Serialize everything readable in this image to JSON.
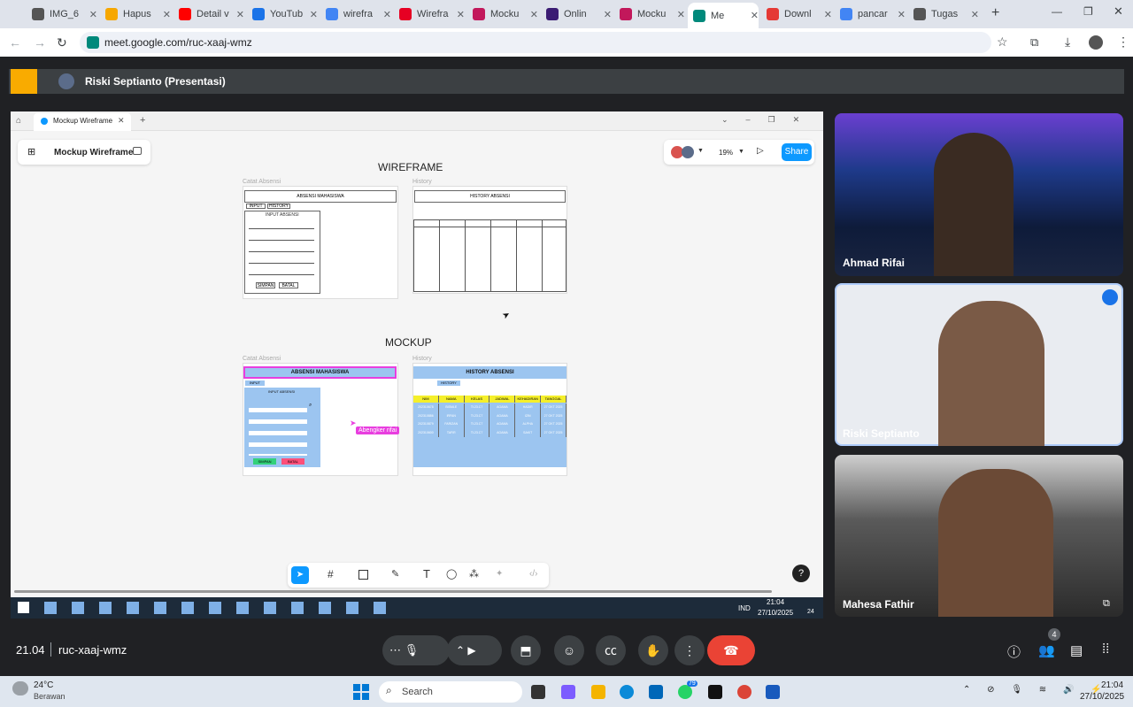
{
  "browser": {
    "tabs": [
      {
        "label": "IMG_6",
        "color": "#555"
      },
      {
        "label": "Hapus",
        "color": "#f6a700"
      },
      {
        "label": "Detail v",
        "color": "#ff0000"
      },
      {
        "label": "YouTub",
        "color": "#1a73e8"
      },
      {
        "label": "wirefra",
        "color": "#4285f4"
      },
      {
        "label": "Wirefra",
        "color": "#e60023"
      },
      {
        "label": "Mocku",
        "color": "#c2185b"
      },
      {
        "label": "Onlin",
        "color": "#3b1c73"
      },
      {
        "label": "Mocku",
        "color": "#c2185b"
      },
      {
        "label": "Me",
        "color": "#00897b"
      },
      {
        "label": "Downl",
        "color": "#e53935"
      },
      {
        "label": "pancar",
        "color": "#4285f4"
      },
      {
        "label": "Tugas",
        "color": "#555"
      }
    ],
    "url": "meet.google.com/ruc-xaaj-wmz"
  },
  "meet": {
    "presenter": "Riski Septianto (Presentasi)",
    "time": "21.04",
    "meeting_code": "ruc-xaaj-wmz",
    "participants_count": "4",
    "participants": [
      {
        "name": "Ahmad Rifai"
      },
      {
        "name": "Riski Septianto"
      },
      {
        "name": "Mahesa Fathir"
      }
    ]
  },
  "figma": {
    "window_title": "Mockup Wireframe",
    "file_name": "Mockup Wireframe",
    "zoom": "19%",
    "share_label": "Share",
    "sections": {
      "wireframe_title": "WIREFRAME",
      "mockup_title": "MOCKUP"
    },
    "frames": {
      "catat_absensi": "Catat Absensi",
      "history": "History",
      "absensi_mahasiswa": "ABSENSI MAHASISWA",
      "history_absensi": "HISTORY ABSENSI",
      "input_absensi": "INPUT ABSENSI",
      "tab_input": "INPUT",
      "tab_history": "HISTORY",
      "simpan": "SIMPAN",
      "batal": "BATAL",
      "table_headers": [
        "NIM",
        "NAMA",
        "KELAS",
        "JADWAL",
        "KEHADIRAN",
        "TANGGAL"
      ],
      "table_rows": [
        [
          "202310678",
          "BISMLE",
          "TI.23.C7",
          "AGAMA",
          "HADIR",
          "27 OKT 2025"
        ],
        [
          "202310886",
          "IRFAN",
          "TI.23.C7",
          "AGAMA",
          "IZIN",
          "27 OKT 2025"
        ],
        [
          "202310879",
          "FARIZAN",
          "TI.23.C7",
          "AGAMA",
          "ALPHA",
          "27 OKT 2025"
        ],
        [
          "202310600",
          "TAFIR",
          "TI.23.C7",
          "AGAMA",
          "SAKIT",
          "27 OKT 2025"
        ]
      ],
      "collaborator_cursor": "Abengker rifai"
    }
  },
  "inner_taskbar": {
    "language": "IND",
    "time": "21:04",
    "date": "27/10/2025",
    "notif": "24"
  },
  "taskbar": {
    "weather_temp": "24°C",
    "weather_desc": "Berawan",
    "search_placeholder": "Search",
    "time": "21:04",
    "date": "27/10/2025",
    "whatsapp_badge": "79"
  }
}
